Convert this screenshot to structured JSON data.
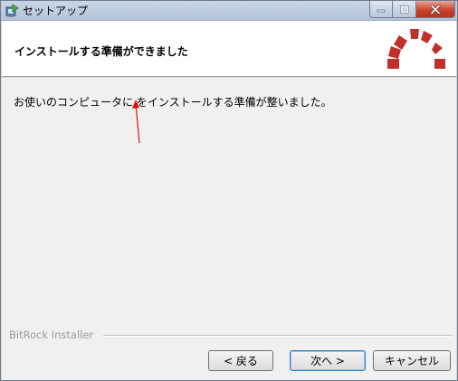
{
  "window": {
    "title": "セットアップ"
  },
  "header": {
    "title": "インストールする準備ができました",
    "logo_color": "#c0302a"
  },
  "main": {
    "message": "お使いのコンピュータに をインストールする準備が整いました。",
    "annotation_arrow_color": "#e01010",
    "brand": "BitRock Installer"
  },
  "buttons": {
    "back": "< 戻る",
    "next": "次へ >",
    "cancel": "キャンセル"
  },
  "icons": {
    "app": "installer-icon",
    "minimize": "minimize-icon",
    "maximize": "maximize-icon",
    "close": "close-icon"
  }
}
